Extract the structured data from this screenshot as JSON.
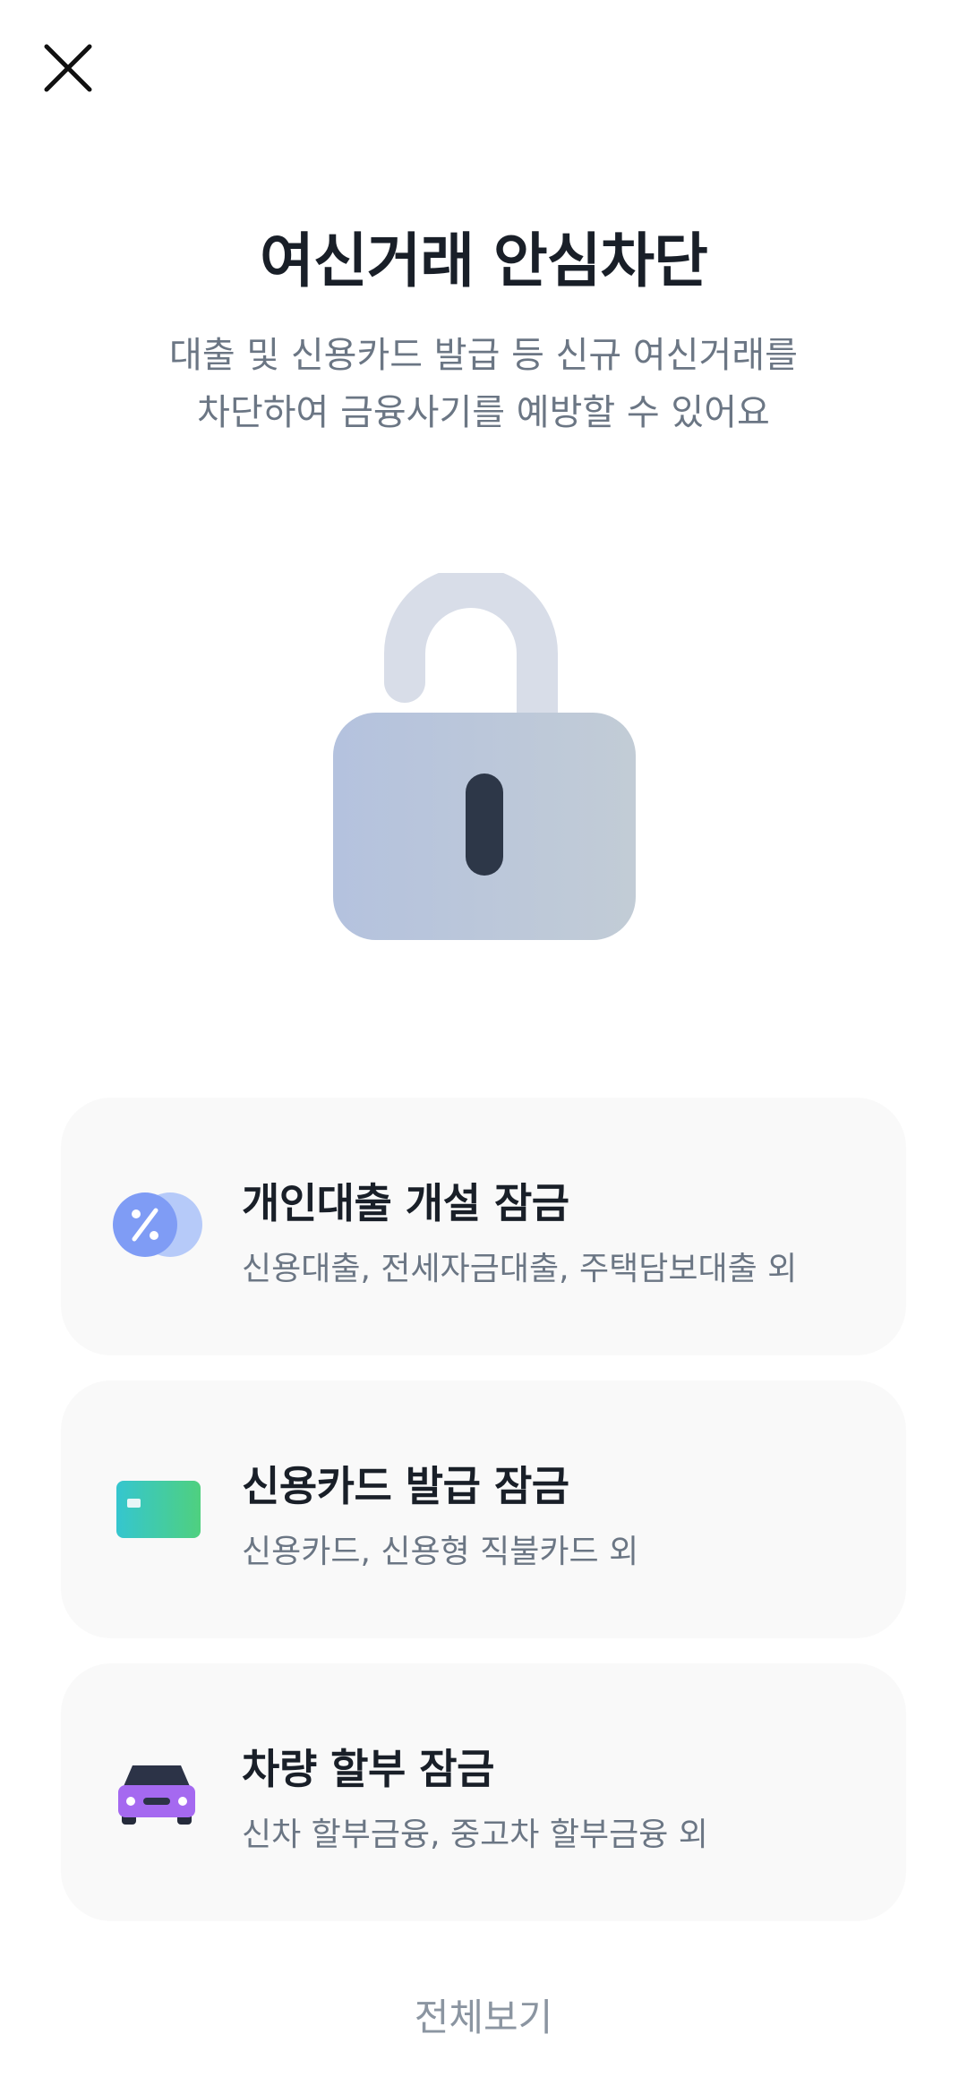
{
  "header": {
    "close_icon": "close-icon",
    "title": "여신거래 안심차단",
    "subtitle_line1": "대출 및 신용카드 발급 등 신규 여신거래를",
    "subtitle_line2": "차단하여 금융사기를 예방할 수 있어요"
  },
  "hero": {
    "icon": "open-padlock-icon"
  },
  "cards": [
    {
      "icon": "loan-percent-icon",
      "title": "개인대출 개설 잠금",
      "desc": "신용대출, 전세자금대출, 주택담보대출 외"
    },
    {
      "icon": "credit-card-icon",
      "title": "신용카드 발급 잠금",
      "desc": "신용카드, 신용형 직불카드 외"
    },
    {
      "icon": "car-icon",
      "title": "차량 할부 잠금",
      "desc": "신차 할부금융, 중고차 할부금융 외"
    }
  ],
  "footer": {
    "view_all": "전체보기"
  },
  "colors": {
    "title": "#191f28",
    "subtitle": "#6b7684",
    "card_bg": "#f9f9f9",
    "view_all": "#8b95a1"
  }
}
